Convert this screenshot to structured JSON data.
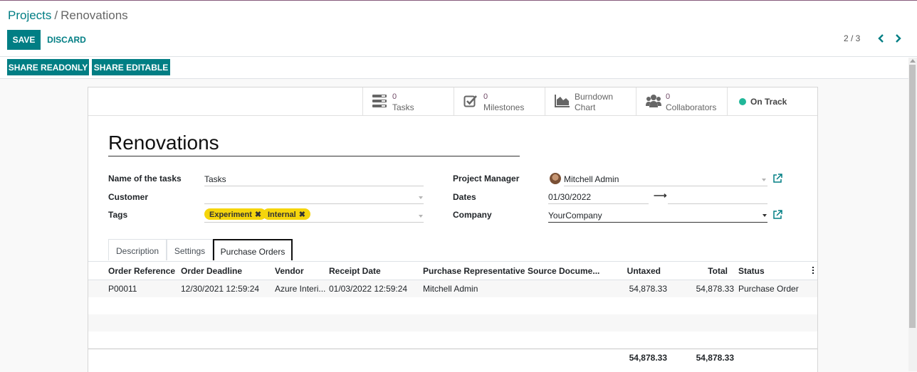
{
  "breadcrumb": {
    "parent": "Projects",
    "separator": "/",
    "current": "Renovations"
  },
  "control_panel": {
    "save_label": "SAVE",
    "discard_label": "DISCARD",
    "pager": "2 / 3"
  },
  "share": {
    "readonly_label": "SHARE READONLY",
    "editable_label": "SHARE EDITABLE"
  },
  "smart_buttons": {
    "tasks": {
      "value": "0",
      "label": "Tasks"
    },
    "milestones": {
      "value": "0",
      "label": "Milestones"
    },
    "burndown": {
      "line1": "Burndown",
      "line2": "Chart"
    },
    "collaborators": {
      "value": "0",
      "label": "Collaborators"
    },
    "status": {
      "label": "On Track",
      "color": "#21b799"
    }
  },
  "form": {
    "title": "Renovations",
    "labels": {
      "tasks_name": "Name of the tasks",
      "customer": "Customer",
      "tags": "Tags",
      "manager": "Project Manager",
      "dates": "Dates",
      "company": "Company"
    },
    "tasks_name": "Tasks",
    "customer": "",
    "tags": [
      "Experiment",
      "Internal"
    ],
    "manager": "Mitchell Admin",
    "date_start": "01/30/2022",
    "date_end": "",
    "date_arrow": "⟶",
    "company": "YourCompany"
  },
  "tabs": [
    "Description",
    "Settings",
    "Purchase Orders"
  ],
  "active_tab": "Purchase Orders",
  "table": {
    "columns": [
      "Order Reference",
      "Order Deadline",
      "Vendor",
      "Receipt Date",
      "Purchase Representative",
      "Source Docume...",
      "Untaxed",
      "Total",
      "Status"
    ],
    "rows": [
      [
        "P00011",
        "12/30/2021 12:59:24",
        "Azure Interi...",
        "01/03/2022 12:59:24",
        "Mitchell Admin",
        "",
        "54,878.33",
        "54,878.33",
        "Purchase Order"
      ]
    ],
    "totals": {
      "untaxed": "54,878.33",
      "total": "54,878.33"
    }
  },
  "colors": {
    "brand": "#017e84",
    "accent": "#714b67",
    "tag": "#f5d50c"
  }
}
